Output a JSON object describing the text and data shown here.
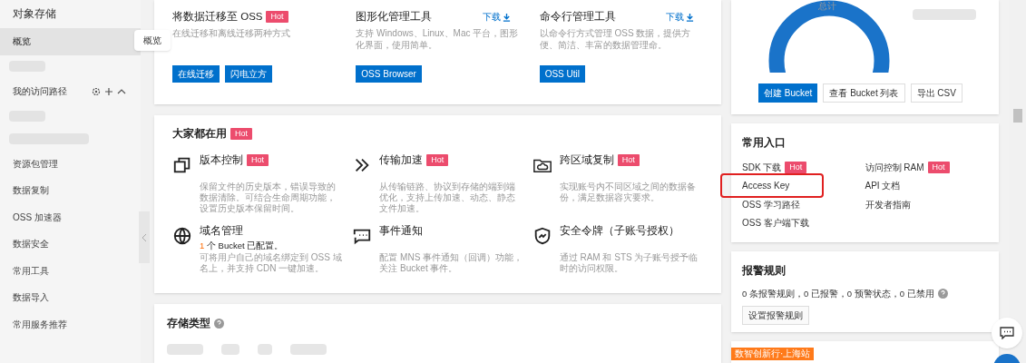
{
  "sidebar": {
    "title": "对象存储",
    "tooltip": "概览",
    "items": [
      {
        "kind": "link",
        "label": "概览",
        "selected": true
      },
      {
        "kind": "blurred"
      },
      {
        "kind": "section",
        "label": "我的访问路径",
        "expanded": true
      },
      {
        "kind": "blurred"
      },
      {
        "kind": "blurred"
      },
      {
        "kind": "link",
        "label": "资源包管理",
        "selected": false
      },
      {
        "kind": "link",
        "label": "数据复制",
        "selected": false
      },
      {
        "kind": "link",
        "label": "OSS 加速器",
        "selected": false
      },
      {
        "kind": "link",
        "label": "数据安全",
        "selected": false
      },
      {
        "kind": "link",
        "label": "常用工具",
        "selected": false
      },
      {
        "kind": "link",
        "label": "数据导入",
        "selected": false
      },
      {
        "kind": "link",
        "label": "常用服务推荐",
        "selected": false
      }
    ]
  },
  "tools": [
    {
      "title": "将数据迁移至 OSS",
      "hot": "Hot",
      "description": "在线迁移和离线迁移两种方式",
      "buttons": [
        "在线迁移",
        "闪电立方"
      ]
    },
    {
      "title": "图形化管理工具",
      "download": "下载",
      "description": "支持 Windows、Linux、Mac 平台，图形化界面，使用简单。",
      "buttons": [
        "OSS Browser"
      ]
    },
    {
      "title": "命令行管理工具",
      "download": "下载",
      "description": "以命令行方式管理 OSS 数据，提供方便、简洁、丰富的数据管理命。",
      "buttons": [
        "OSS Util"
      ]
    }
  ],
  "popular": {
    "title": "大家都在用",
    "hot": "Hot",
    "features": [
      {
        "kind": "versions",
        "title": "版本控制",
        "hot": "Hot",
        "description": "保留文件的历史版本，错误导致的数据清除。可结合生命周期功能，设置历史版本保留时间。"
      },
      {
        "kind": "transfer",
        "title": "传输加速",
        "hot": "Hot",
        "description": "从传输链路、协议到存储的端到端优化，支持上传加速、动态、静态文件加速。"
      },
      {
        "kind": "replication",
        "title": "跨区域复制",
        "hot": "Hot",
        "description": "实现账号内不同区域之间的数据备份，满足数据容灾要求。"
      },
      {
        "kind": "domain",
        "title": "域名管理",
        "count": "1",
        "note": " 个 Bucket 已配置。",
        "description": "可将用户自己的域名绑定到 OSS 域名上，并支持 CDN 一键加速。"
      },
      {
        "kind": "event",
        "title": "事件通知",
        "description": "配置 MNS 事件通知（回调）功能，关注 Bucket 事件。"
      },
      {
        "kind": "token",
        "title": "安全令牌（子账号授权）",
        "description": "通过 RAM 和 STS 为子账号授予临时的访问权限。"
      }
    ]
  },
  "storage": {
    "title": "存储类型"
  },
  "overview": {
    "total_label": "总计",
    "buttons": [
      {
        "label": "创建 Bucket",
        "primary": true
      },
      {
        "label": "查看 Bucket 列表",
        "primary": false
      },
      {
        "label": "导出 CSV",
        "primary": false
      }
    ]
  },
  "shortcuts": {
    "title": "常用入口",
    "links": [
      {
        "label": "SDK 下载",
        "hot": "Hot",
        "highlighted": false
      },
      {
        "label": "访问控制 RAM",
        "hot": "Hot",
        "highlighted": false
      },
      {
        "label": "Access Key",
        "highlighted": true
      },
      {
        "label": "API 文档",
        "highlighted": false
      },
      {
        "label": "OSS 学习路径",
        "highlighted": false
      },
      {
        "label": "开发者指南",
        "highlighted": false
      },
      {
        "label": "OSS 客户端下载",
        "highlighted": false
      }
    ]
  },
  "alerts": {
    "title": "报警规则",
    "summary": "0 条报警规则，0 已报警，0 预警状态，0 已禁用",
    "button": "设置报警规则"
  },
  "promo": {
    "tag": "数智创新行·上海站"
  }
}
